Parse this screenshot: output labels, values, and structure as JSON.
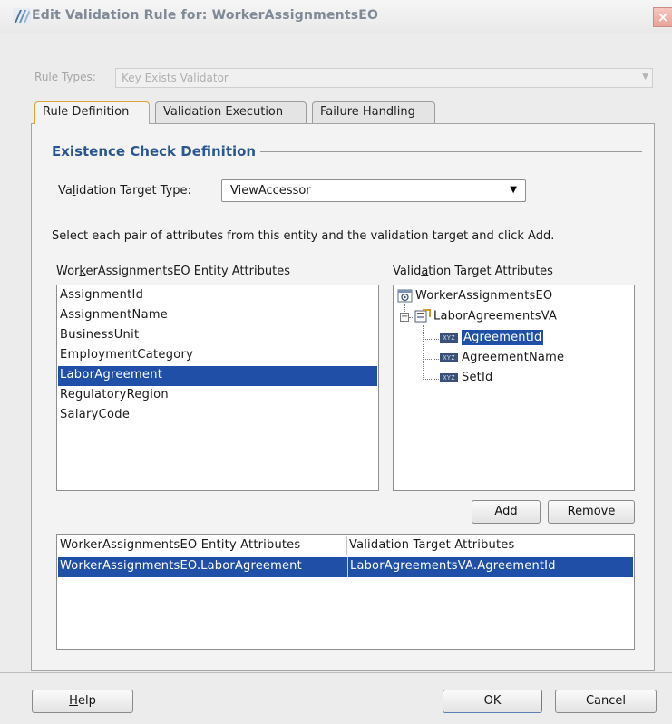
{
  "window": {
    "title": "Edit Validation Rule for: WorkerAssignmentsEO",
    "close_glyph": "×"
  },
  "rule_types": {
    "label_prefix": "R",
    "label_rest": "ule Types:",
    "value": "Key Exists Validator"
  },
  "tabs": [
    {
      "label": "Rule Definition",
      "active": true
    },
    {
      "label": "Validation Execution",
      "active": false
    },
    {
      "label": "Failure Handling",
      "active": false
    }
  ],
  "section": {
    "title": "Existence Check Definition"
  },
  "validation_target_type": {
    "label_pre": "Va",
    "label_mnemonic": "l",
    "label_post": "idation Target Type:",
    "value": "ViewAccessor"
  },
  "instructions": "Select each pair of attributes from this entity and the validation target and click Add.",
  "entity_attributes": {
    "label_pre": "Wor",
    "label_mnemonic": "k",
    "label_post": "erAssignmentsEO Entity Attributes",
    "items": [
      {
        "label": "AssignmentId",
        "selected": false
      },
      {
        "label": "AssignmentName",
        "selected": false
      },
      {
        "label": "BusinessUnit",
        "selected": false
      },
      {
        "label": "EmploymentCategory",
        "selected": false
      },
      {
        "label": "LaborAgreement",
        "selected": true
      },
      {
        "label": "RegulatoryRegion",
        "selected": false
      },
      {
        "label": "SalaryCode",
        "selected": false
      }
    ]
  },
  "target_attributes": {
    "label_pre": "Valid",
    "label_mnemonic": "a",
    "label_post": "tion Target Attributes",
    "root": "WorkerAssignmentsEO",
    "accessor": "LaborAgreementsVA",
    "expander_glyph": "−",
    "attr_icon_text": "XYZ",
    "children": [
      {
        "label": "AgreementId",
        "selected": true
      },
      {
        "label": "AgreementName",
        "selected": false
      },
      {
        "label": "SetId",
        "selected": false
      }
    ]
  },
  "buttons": {
    "add_mnemonic": "A",
    "add_rest": "dd",
    "remove_mnemonic": "R",
    "remove_rest": "emove",
    "help_mnemonic": "H",
    "help_rest": "elp",
    "ok": "OK",
    "cancel": "Cancel"
  },
  "pairs_table": {
    "columns": [
      "WorkerAssignmentsEO Entity Attributes",
      "Validation Target Attributes"
    ],
    "rows": [
      {
        "entity": "WorkerAssignmentsEO.LaborAgreement",
        "target": "LaborAgreementsVA.AgreementId"
      }
    ]
  },
  "colors": {
    "selection": "#1f4fa7",
    "section_title": "#2b5690",
    "active_tab_border": "#d9a33a"
  }
}
